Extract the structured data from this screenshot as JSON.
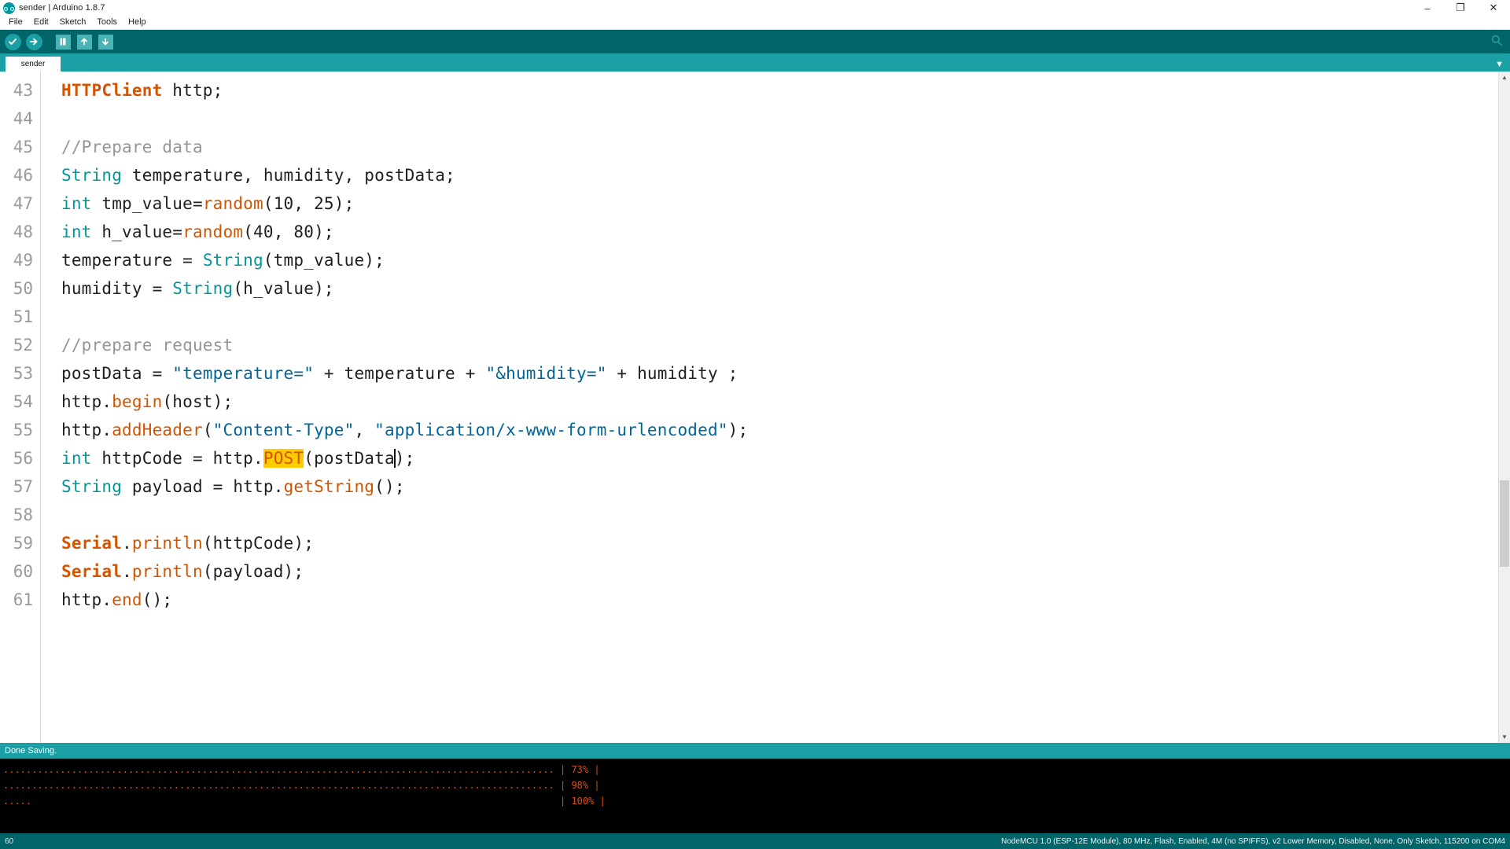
{
  "window": {
    "title": "sender | Arduino 1.8.7",
    "logo_icon": "arduino-infinity-icon",
    "controls": {
      "minimize": "–",
      "maximize": "❐",
      "close": "✕"
    }
  },
  "menubar": {
    "items": [
      {
        "label": "File"
      },
      {
        "label": "Edit"
      },
      {
        "label": "Sketch"
      },
      {
        "label": "Tools"
      },
      {
        "label": "Help"
      }
    ]
  },
  "toolbar": {
    "buttons": [
      {
        "name": "verify-button",
        "icon": "checkmark-icon",
        "glyph": "✓",
        "tooltip": "Verify"
      },
      {
        "name": "upload-button",
        "icon": "arrow-right-icon",
        "glyph": "→",
        "tooltip": "Upload"
      },
      {
        "name": "new-button",
        "icon": "new-file-icon",
        "glyph": "▫",
        "tooltip": "New"
      },
      {
        "name": "open-button",
        "icon": "arrow-up-icon",
        "glyph": "↑",
        "tooltip": "Open"
      },
      {
        "name": "save-button",
        "icon": "arrow-down-icon",
        "glyph": "↓",
        "tooltip": "Save"
      }
    ],
    "serial_monitor": {
      "icon": "magnifier-icon",
      "glyph": "⚲",
      "tooltip": "Serial Monitor"
    }
  },
  "tabs": {
    "items": [
      {
        "label": "sender",
        "active": true
      }
    ],
    "menu_arrow_icon": "chevron-down-icon",
    "menu_arrow_glyph": "▼"
  },
  "editor": {
    "first_line_number": 43,
    "line_numbers": [
      43,
      44,
      45,
      46,
      47,
      48,
      49,
      50,
      51,
      52,
      53,
      54,
      55,
      56,
      57,
      58,
      59,
      60,
      61
    ],
    "lines": [
      {
        "n": 43,
        "tokens": [
          {
            "t": "HTTPClient",
            "c": "tok-type"
          },
          {
            "t": " http;",
            "c": "tok-plain"
          }
        ]
      },
      {
        "n": 44,
        "tokens": [
          {
            "t": "",
            "c": "tok-plain"
          }
        ]
      },
      {
        "n": 45,
        "tokens": [
          {
            "t": "//Prepare data",
            "c": "tok-cmt"
          }
        ]
      },
      {
        "n": 46,
        "tokens": [
          {
            "t": "String",
            "c": "tok-kw"
          },
          {
            "t": " temperature, humidity, postData;",
            "c": "tok-plain"
          }
        ]
      },
      {
        "n": 47,
        "tokens": [
          {
            "t": "int",
            "c": "tok-kw"
          },
          {
            "t": " tmp_value=",
            "c": "tok-plain"
          },
          {
            "t": "random",
            "c": "tok-fn"
          },
          {
            "t": "(10, 25);",
            "c": "tok-plain"
          }
        ]
      },
      {
        "n": 48,
        "tokens": [
          {
            "t": "int",
            "c": "tok-kw"
          },
          {
            "t": " h_value=",
            "c": "tok-plain"
          },
          {
            "t": "random",
            "c": "tok-fn"
          },
          {
            "t": "(40, 80);",
            "c": "tok-plain"
          }
        ]
      },
      {
        "n": 49,
        "tokens": [
          {
            "t": "temperature = ",
            "c": "tok-plain"
          },
          {
            "t": "String",
            "c": "tok-kw"
          },
          {
            "t": "(tmp_value);",
            "c": "tok-plain"
          }
        ]
      },
      {
        "n": 50,
        "tokens": [
          {
            "t": "humidity = ",
            "c": "tok-plain"
          },
          {
            "t": "String",
            "c": "tok-kw"
          },
          {
            "t": "(h_value);",
            "c": "tok-plain"
          }
        ]
      },
      {
        "n": 51,
        "tokens": [
          {
            "t": "",
            "c": "tok-plain"
          }
        ]
      },
      {
        "n": 52,
        "tokens": [
          {
            "t": "//prepare request",
            "c": "tok-cmt"
          }
        ]
      },
      {
        "n": 53,
        "tokens": [
          {
            "t": "postData = ",
            "c": "tok-plain"
          },
          {
            "t": "\"temperature=\"",
            "c": "tok-str"
          },
          {
            "t": " + temperature + ",
            "c": "tok-plain"
          },
          {
            "t": "\"&humidity=\"",
            "c": "tok-str"
          },
          {
            "t": " + humidity ;",
            "c": "tok-plain"
          }
        ]
      },
      {
        "n": 54,
        "tokens": [
          {
            "t": "http.",
            "c": "tok-plain"
          },
          {
            "t": "begin",
            "c": "tok-fn"
          },
          {
            "t": "(host);",
            "c": "tok-plain"
          }
        ]
      },
      {
        "n": 55,
        "tokens": [
          {
            "t": "http.",
            "c": "tok-plain"
          },
          {
            "t": "addHeader",
            "c": "tok-fn"
          },
          {
            "t": "(",
            "c": "tok-plain"
          },
          {
            "t": "\"Content-Type\"",
            "c": "tok-str"
          },
          {
            "t": ", ",
            "c": "tok-plain"
          },
          {
            "t": "\"application/x-www-form-urlencoded\"",
            "c": "tok-str"
          },
          {
            "t": ");",
            "c": "tok-plain"
          }
        ]
      },
      {
        "n": 56,
        "tokens": [
          {
            "t": "int",
            "c": "tok-kw"
          },
          {
            "t": " httpCode = http.",
            "c": "tok-plain"
          },
          {
            "t": "POST",
            "c": "tok-hl"
          },
          {
            "t": "(postData",
            "c": "tok-plain"
          },
          {
            "t": "CARET",
            "c": "caret"
          },
          {
            "t": ");",
            "c": "tok-plain"
          }
        ]
      },
      {
        "n": 57,
        "tokens": [
          {
            "t": "String",
            "c": "tok-kw"
          },
          {
            "t": " payload = http.",
            "c": "tok-plain"
          },
          {
            "t": "getString",
            "c": "tok-fn"
          },
          {
            "t": "();",
            "c": "tok-plain"
          }
        ]
      },
      {
        "n": 58,
        "tokens": [
          {
            "t": "",
            "c": "tok-plain"
          }
        ]
      },
      {
        "n": 59,
        "tokens": [
          {
            "t": "Serial",
            "c": "tok-type"
          },
          {
            "t": ".",
            "c": "tok-plain"
          },
          {
            "t": "println",
            "c": "tok-fn"
          },
          {
            "t": "(httpCode);",
            "c": "tok-plain"
          }
        ]
      },
      {
        "n": 60,
        "tokens": [
          {
            "t": "Serial",
            "c": "tok-type"
          },
          {
            "t": ".",
            "c": "tok-plain"
          },
          {
            "t": "println",
            "c": "tok-fn"
          },
          {
            "t": "(payload);",
            "c": "tok-plain"
          }
        ]
      },
      {
        "n": 61,
        "tokens": [
          {
            "t": "http.",
            "c": "tok-plain"
          },
          {
            "t": "end",
            "c": "tok-fn"
          },
          {
            "t": "();",
            "c": "tok-plain"
          }
        ]
      }
    ],
    "scrollbar": {
      "up_arrow_icon": "caret-up-icon",
      "up_arrow_glyph": "▲",
      "down_arrow_icon": "caret-down-icon",
      "down_arrow_glyph": "▼"
    }
  },
  "status": {
    "message": "Done Saving."
  },
  "console": {
    "lines": [
      {
        "text": "................................................................................................. | 73% |"
      },
      {
        "text": "................................................................................................. | 98% |"
      },
      {
        "text": ".....                                                                                             | 100% |"
      }
    ]
  },
  "bottombar": {
    "line_indicator": "60",
    "board_info": "NodeMCU 1.0 (ESP-12E Module), 80 MHz, Flash, Enabled, 4M (no SPIFFS), v2 Lower Memory, Disabled, None, Only Sketch, 115200 on COM4"
  }
}
